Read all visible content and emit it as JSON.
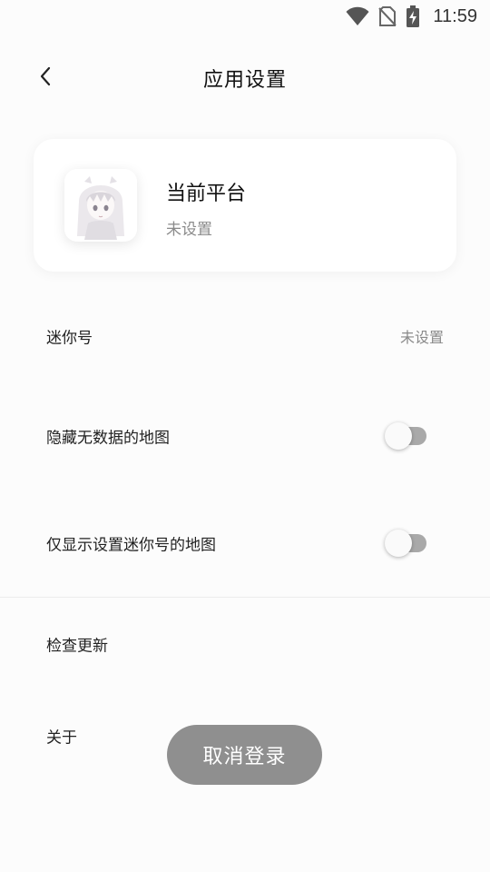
{
  "status_bar": {
    "time": "11:59",
    "icons": [
      "wifi-icon",
      "no-sim-icon",
      "battery-charging-icon"
    ]
  },
  "app_bar": {
    "back_icon": "chevron-left-icon",
    "title": "应用设置"
  },
  "platform_card": {
    "title": "当前平台",
    "subtitle": "未设置",
    "avatar": "anime-girl-avatar"
  },
  "settings": {
    "mini_id": {
      "label": "迷你号",
      "value": "未设置"
    },
    "hide_no_data": {
      "label": "隐藏无数据的地图",
      "enabled": false
    },
    "only_mini_id": {
      "label": "仅显示设置迷你号的地图",
      "enabled": false
    },
    "check_update": {
      "label": "检查更新"
    },
    "about": {
      "label": "关于"
    }
  },
  "logout_button": {
    "label": "取消登录"
  },
  "colors": {
    "background": "#fcfcfc",
    "card": "#ffffff",
    "switch_track_off": "#a9a9a9",
    "logout_button": "#8f8f8f"
  }
}
